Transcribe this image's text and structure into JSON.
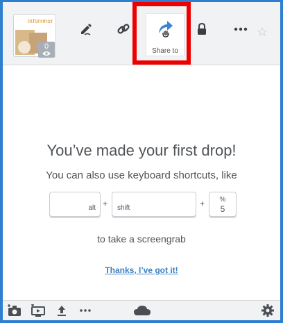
{
  "toolbar": {
    "thumbnail_caption": "inforrmor",
    "view_count": "0",
    "share_label": "Share to",
    "icons": {
      "edit": "pen-icon",
      "link": "link-icon",
      "share": "share-arrow-icon",
      "lock": "lock-icon",
      "more": "more-icon",
      "favorite": "star-icon"
    }
  },
  "main": {
    "headline": "You’ve made your first drop!",
    "subtext": "You can also use keyboard shortcuts, like",
    "keys": {
      "alt": "alt",
      "shift": "shift",
      "percent": "%",
      "five": "5"
    },
    "plus": "+",
    "tail": "to take a screengrab",
    "dismiss": "Thanks, I’ve got it!"
  },
  "bottombar": {
    "icons": [
      "camera-icon",
      "screen-record-icon",
      "upload-icon",
      "more-icon",
      "cloud-icon",
      "gear-icon"
    ]
  },
  "colors": {
    "frame": "#2f7fd0",
    "highlight": "#ee0000",
    "link": "#3b82c4",
    "share_arrow": "#3f83d0"
  }
}
